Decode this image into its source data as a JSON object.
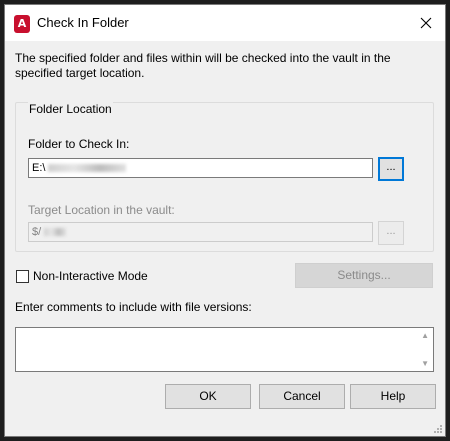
{
  "window": {
    "title": "Check In Folder",
    "icon_glyph": "A",
    "icon_color": "#c8102e",
    "close_glyph": "✕"
  },
  "description": "The specified folder and files within will be checked into the vault in the specified target location.",
  "folder_location": {
    "group_title": "Folder Location",
    "check_in_label": "Folder to Check In:",
    "check_in_value": "E:\\",
    "check_in_browse": "...",
    "target_label": "Target Location in the vault:",
    "target_value": "$/",
    "target_browse": "..."
  },
  "options": {
    "non_interactive_label": "Non-Interactive Mode",
    "non_interactive_checked": false,
    "settings_label": "Settings..."
  },
  "comments": {
    "label": "Enter comments to include with file versions:",
    "value": ""
  },
  "buttons": {
    "ok": "OK",
    "cancel": "Cancel",
    "help": "Help"
  },
  "colors": {
    "focus_border": "#0078d7",
    "dialog_bg": "#f0f0f0"
  }
}
